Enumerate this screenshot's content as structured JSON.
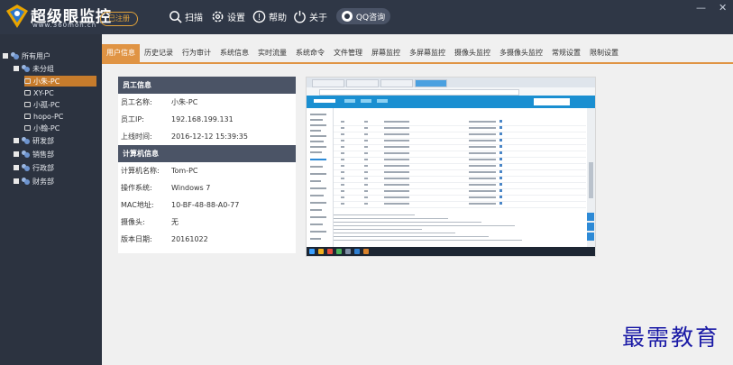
{
  "app": {
    "brand": "超级眼监控",
    "site": "www.360mon.cn",
    "reg_badge": "已注册",
    "toolbar": [
      {
        "label": "扫描",
        "icon": "scan-icon"
      },
      {
        "label": "设置",
        "icon": "gear-icon"
      },
      {
        "label": "帮助",
        "icon": "help-icon"
      },
      {
        "label": "关于",
        "icon": "info-icon"
      }
    ],
    "qq_button": "QQ咨询",
    "window": {
      "minimize": "—",
      "close": "✕"
    }
  },
  "tree": {
    "root": "所有用户",
    "group_open": "未分组",
    "pcs": [
      "小朱-PC",
      "XY-PC",
      "小孤-PC",
      "hopo-PC",
      "小翰-PC"
    ],
    "selected_pc": "小朱-PC",
    "other_groups": [
      "研发部",
      "销售部",
      "行政部",
      "财务部"
    ]
  },
  "tabs": [
    "用户信息",
    "历史记录",
    "行为审计",
    "系统信息",
    "实时流量",
    "系统命令",
    "文件管理",
    "屏幕监控",
    "多屏幕监控",
    "摄像头监控",
    "多摄像头监控",
    "常规设置",
    "限制设置"
  ],
  "active_tab": "用户信息",
  "employee": {
    "title": "员工信息",
    "name_label": "员工名称:",
    "name": "小朱-PC",
    "ip_label": "员工IP:",
    "ip": "192.168.199.131",
    "online_label": "上线时间:",
    "online": "2016-12-12 15:39:35"
  },
  "computer": {
    "title": "计算机信息",
    "pcname_label": "计算机名称:",
    "pcname": "Tom-PC",
    "os_label": "操作系统:",
    "os": "Windows 7",
    "mac_label": "MAC地址:",
    "mac": "10-BF-48-88-A0-77",
    "camera_label": "摄像头:",
    "camera": "无",
    "version_label": "版本日期:",
    "version": "20161022"
  },
  "watermark": "最需教育"
}
